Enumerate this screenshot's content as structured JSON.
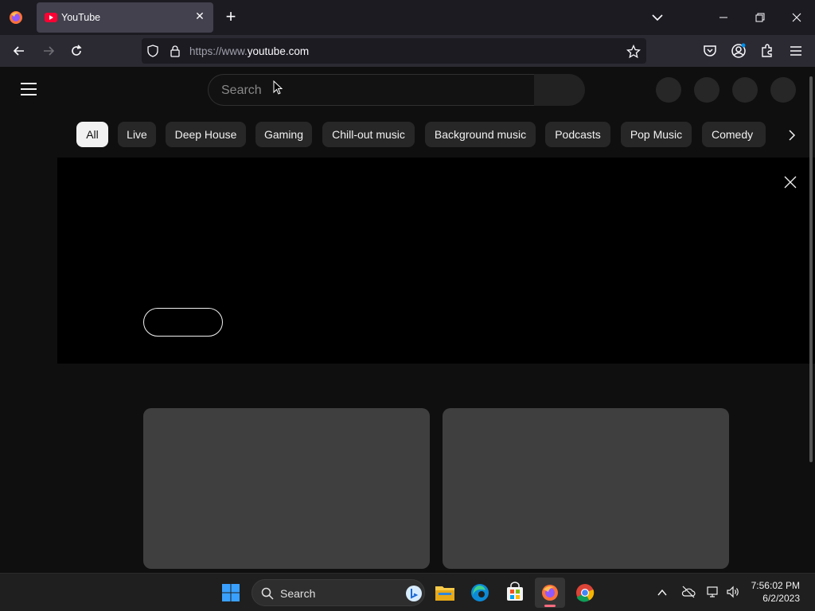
{
  "browser": {
    "tab_title": "YouTube",
    "url_prefix": "https://www.",
    "url_domain": "youtube.com"
  },
  "youtube": {
    "search_placeholder": "Search",
    "chips": [
      {
        "label": "All",
        "active": true
      },
      {
        "label": "Live"
      },
      {
        "label": "Deep House"
      },
      {
        "label": "Gaming"
      },
      {
        "label": "Chill-out music"
      },
      {
        "label": "Background music"
      },
      {
        "label": "Podcasts"
      },
      {
        "label": "Pop Music"
      },
      {
        "label": "Comedy"
      }
    ]
  },
  "taskbar": {
    "search_label": "Search",
    "time": "7:56:02 PM",
    "date": "6/2/2023"
  },
  "colors": {
    "page_bg": "#0f0f0f",
    "chip_bg": "#272727",
    "chip_active_bg": "#f1f1f1",
    "youtube_red": "#ff0033"
  }
}
